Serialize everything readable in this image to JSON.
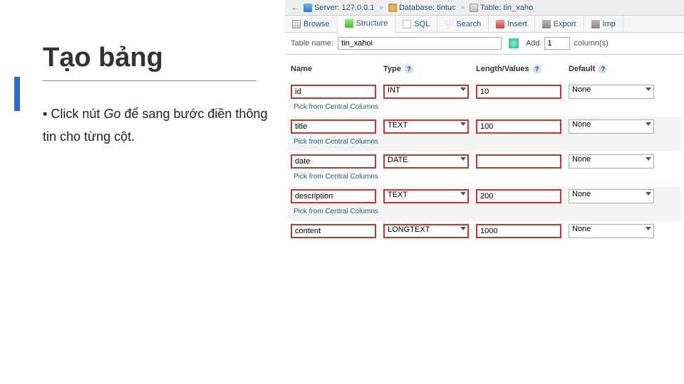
{
  "slide": {
    "title": "Tạo bảng",
    "bullet_prefix": "▪",
    "body_pre": "Click  nút ",
    "body_em": "Go",
    "body_post": " để  sang bước  điền  thông  tin cho từng cột."
  },
  "breadcrumb": {
    "back": "←",
    "server_label": "Server:",
    "server_val": "127.0.0.1",
    "db_label": "Database:",
    "db_val": "tintuc",
    "table_label": "Table:",
    "table_val": "tin_xaho",
    "sep": "»"
  },
  "tabs": {
    "browse": "Browse",
    "structure": "Structure",
    "sql": "SQL",
    "search": "Search",
    "insert": "Insert",
    "export": "Export",
    "import": "Imp"
  },
  "tablename": {
    "label": "Table name:",
    "value": "tin_xahoi",
    "add_label": "Add",
    "add_value": "1",
    "columns_label": "column(s)"
  },
  "headers": {
    "name": "Name",
    "type": "Type",
    "length": "Length/Values",
    "default": "Default",
    "help": "?"
  },
  "rows": [
    {
      "name": "id",
      "type": "INT",
      "length": "10",
      "default": "None",
      "hl": true,
      "alt": false
    },
    {
      "name": "title",
      "type": "TEXT",
      "length": "100",
      "default": "None",
      "hl": true,
      "alt": true
    },
    {
      "name": "date",
      "type": "DATE",
      "length": "",
      "default": "None",
      "hl": true,
      "alt": false
    },
    {
      "name": "description",
      "type": "TEXT",
      "length": "200",
      "default": "None",
      "hl": true,
      "alt": true
    },
    {
      "name": "content",
      "type": "LONGTEXT",
      "length": "1000",
      "default": "None",
      "hl": true,
      "alt": false
    }
  ],
  "pick_label": "Pick from Central Columns"
}
